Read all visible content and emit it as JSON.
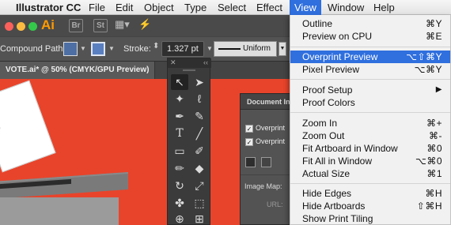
{
  "menubar": {
    "app_name": "Illustrator CC",
    "items": [
      "File",
      "Edit",
      "Object",
      "Type",
      "Select",
      "Effect",
      "View",
      "Window",
      "Help"
    ],
    "active": "View"
  },
  "appbar": {
    "logo": "Ai",
    "bridge": "Br",
    "stock": "St"
  },
  "controlbar": {
    "selection_label": "Compound Path",
    "stroke_label": "Stroke:",
    "stroke_value": "1.327 pt",
    "profile_label": "Uniform",
    "fill_color": "#4d6fa3",
    "stroke_color": "#5a7fc0"
  },
  "document": {
    "tab_title": "VOTE.ai* @ 50% (CMYK/GPU Preview)"
  },
  "canvas": {
    "background": "#e8442b"
  },
  "doc_info_panel": {
    "title": "Document Info",
    "options": [
      {
        "label": "Overprint",
        "checked": true
      },
      {
        "label": "Overprint",
        "checked": true
      }
    ],
    "image_map_label": "Image Map:",
    "url_label": "URL:"
  },
  "view_menu": {
    "highlight_color": "#2f6fde",
    "items": [
      {
        "label": "Outline",
        "shortcut": "⌘Y"
      },
      {
        "label": "Preview on CPU",
        "shortcut": "⌘E"
      },
      {
        "label": "Overprint Preview",
        "shortcut": "⌥⇧⌘Y",
        "highlighted": true
      },
      {
        "label": "Pixel Preview",
        "shortcut": "⌥⌘Y"
      },
      {
        "label": "Proof Setup",
        "shortcut": "▶"
      },
      {
        "label": "Proof Colors",
        "shortcut": ""
      },
      {
        "label": "Zoom In",
        "shortcut": "⌘+"
      },
      {
        "label": "Zoom Out",
        "shortcut": "⌘-"
      },
      {
        "label": "Fit Artboard in Window",
        "shortcut": "⌘0"
      },
      {
        "label": "Fit All in Window",
        "shortcut": "⌥⌘0"
      },
      {
        "label": "Actual Size",
        "shortcut": "⌘1"
      },
      {
        "label": "Hide Edges",
        "shortcut": "⌘H"
      },
      {
        "label": "Hide Artboards",
        "shortcut": "⇧⌘H"
      },
      {
        "label": "Show Print Tiling",
        "shortcut": ""
      }
    ]
  }
}
